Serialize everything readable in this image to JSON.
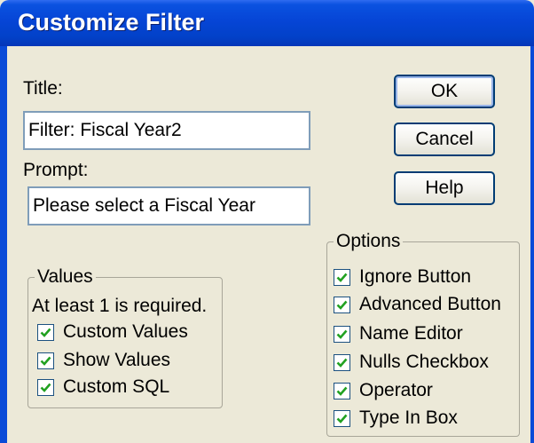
{
  "window": {
    "title": "Customize Filter"
  },
  "form": {
    "title_label": "Title:",
    "title_value": "Filter: Fiscal Year2",
    "prompt_label": "Prompt:",
    "prompt_value": "Please select a Fiscal Year"
  },
  "buttons": {
    "ok": "OK",
    "cancel": "Cancel",
    "help": "Help"
  },
  "values_group": {
    "legend": "Values",
    "note": "At least 1 is required.",
    "items": [
      {
        "label": "Custom Values",
        "checked": true
      },
      {
        "label": "Show Values",
        "checked": true
      },
      {
        "label": "Custom SQL",
        "checked": true
      }
    ]
  },
  "options_group": {
    "legend": "Options",
    "items": [
      {
        "label": "Ignore Button",
        "checked": true
      },
      {
        "label": "Advanced Button",
        "checked": true
      },
      {
        "label": "Name Editor",
        "checked": true
      },
      {
        "label": "Nulls Checkbox",
        "checked": true
      },
      {
        "label": "Operator",
        "checked": true
      },
      {
        "label": "Type In Box",
        "checked": true
      }
    ]
  },
  "colors": {
    "titlebar": "#0645d6",
    "checkmark": "#21a121",
    "face": "#ece9d8"
  }
}
